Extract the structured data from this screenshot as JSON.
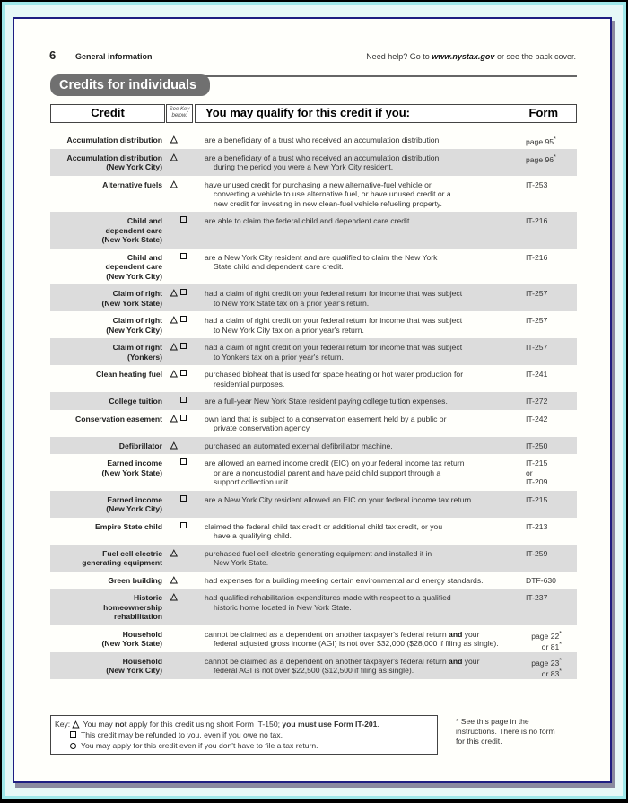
{
  "header": {
    "page_number": "6",
    "section": "General information",
    "help_prefix": "Need help? Go to ",
    "help_link": "www.nystax.gov",
    "help_suffix": " or see the back cover."
  },
  "title": "Credits for individuals",
  "table_header": {
    "credit": "Credit",
    "key_line1": "See Key",
    "key_line2": "below.",
    "qualify": "You may qualify for this credit if you:",
    "form": "Form"
  },
  "rows": [
    {
      "credit": [
        "Accumulation distribution"
      ],
      "keys": [
        "triangle"
      ],
      "desc": [
        "are a beneficiary of a trust who received an accumulation distribution."
      ],
      "form": [
        "page 95*"
      ],
      "shaded": false
    },
    {
      "credit": [
        "Accumulation distribution",
        "(New York City)"
      ],
      "keys": [
        "triangle"
      ],
      "desc": [
        "are a beneficiary of a trust who received an accumulation distribution",
        "during the period you were a New York City resident."
      ],
      "form": [
        "page 96*"
      ],
      "shaded": true
    },
    {
      "credit": [
        "Alternative fuels"
      ],
      "keys": [
        "triangle"
      ],
      "desc": [
        "have unused credit for purchasing a new alternative-fuel vehicle or",
        "converting a vehicle to use alternative fuel, or have unused credit or a",
        "new credit for investing in new clean-fuel vehicle refueling property."
      ],
      "form": [
        "IT-253"
      ],
      "shaded": false
    },
    {
      "credit": [
        "Child and",
        "dependent care",
        "(New York State)"
      ],
      "keys": [
        "square"
      ],
      "desc": [
        "are able to claim the federal child and dependent care credit."
      ],
      "form": [
        "IT-216"
      ],
      "shaded": true
    },
    {
      "credit": [
        "Child and",
        "dependent care",
        "(New York City)"
      ],
      "keys": [
        "square"
      ],
      "desc": [
        "are a New York City resident and are qualified to claim the New York",
        "State child and dependent care credit."
      ],
      "form": [
        "IT-216"
      ],
      "shaded": false
    },
    {
      "credit": [
        "Claim of right",
        "(New York State)"
      ],
      "keys": [
        "triangle",
        "square"
      ],
      "desc": [
        "had a claim of right credit on your federal return for income that was subject",
        "to New York State tax on a prior year's return."
      ],
      "form": [
        "IT-257"
      ],
      "shaded": true
    },
    {
      "credit": [
        "Claim of right",
        "(New York City)"
      ],
      "keys": [
        "triangle",
        "square"
      ],
      "desc": [
        "had a claim of right credit on your federal return for income that was subject",
        "to New York City tax on a prior year's return."
      ],
      "form": [
        "IT-257"
      ],
      "shaded": false
    },
    {
      "credit": [
        "Claim of right",
        "(Yonkers)"
      ],
      "keys": [
        "triangle",
        "square"
      ],
      "desc": [
        "had a claim of right credit on your federal return for income that was subject",
        "to Yonkers tax on a prior year's return."
      ],
      "form": [
        "IT-257"
      ],
      "shaded": true
    },
    {
      "credit": [
        "Clean heating fuel"
      ],
      "keys": [
        "triangle",
        "square"
      ],
      "desc": [
        "purchased bioheat that is used for space heating or hot water production for",
        "residential purposes."
      ],
      "form": [
        "IT-241"
      ],
      "shaded": false
    },
    {
      "credit": [
        "College tuition"
      ],
      "keys": [
        "square"
      ],
      "desc": [
        "are a full-year New York State resident paying college tuition expenses."
      ],
      "form": [
        "IT-272"
      ],
      "shaded": true
    },
    {
      "credit": [
        "Conservation easement"
      ],
      "keys": [
        "triangle",
        "square"
      ],
      "desc": [
        "own land that is subject to a conservation easement held by a public or",
        "private conservation agency."
      ],
      "form": [
        "IT-242"
      ],
      "shaded": false
    },
    {
      "credit": [
        "Defibrillator"
      ],
      "keys": [
        "triangle"
      ],
      "desc": [
        "purchased an automated external defibrillator machine."
      ],
      "form": [
        "IT-250"
      ],
      "shaded": true
    },
    {
      "credit": [
        "Earned income",
        "(New York State)"
      ],
      "keys": [
        "square"
      ],
      "desc": [
        "are allowed an earned income credit (EIC) on your federal income tax return",
        "or are a noncustodial parent and have paid child support through a",
        "support collection unit."
      ],
      "form": [
        "IT-215",
        "or",
        "IT-209"
      ],
      "shaded": false
    },
    {
      "credit": [
        "Earned income",
        "(New York City)"
      ],
      "keys": [
        "square"
      ],
      "desc": [
        "are a New York City resident allowed an EIC on your federal income tax return."
      ],
      "form": [
        "IT-215"
      ],
      "shaded": true
    },
    {
      "credit": [
        "Empire State child"
      ],
      "keys": [
        "square"
      ],
      "desc": [
        "claimed the federal child tax credit or additional child tax credit, or you",
        "have a qualifying child."
      ],
      "form": [
        "IT-213"
      ],
      "shaded": false
    },
    {
      "credit": [
        "Fuel cell electric",
        "generating equipment"
      ],
      "keys": [
        "triangle"
      ],
      "desc": [
        "purchased fuel cell electric generating equipment and installed it in",
        "New York State."
      ],
      "form": [
        "IT-259"
      ],
      "shaded": true
    },
    {
      "credit": [
        "Green building"
      ],
      "keys": [
        "triangle"
      ],
      "desc": [
        "had expenses for a building meeting certain environmental and energy standards."
      ],
      "form": [
        "DTF-630"
      ],
      "shaded": false
    },
    {
      "credit": [
        "Historic",
        "homeownership",
        "rehabilitation"
      ],
      "keys": [
        "triangle"
      ],
      "desc": [
        "had qualified rehabilitation expenditures made with respect to a qualified",
        "historic home located in New York State."
      ],
      "form": [
        "IT-237"
      ],
      "shaded": true
    },
    {
      "credit": [
        "Household",
        "(New York State)"
      ],
      "keys": [],
      "desc": [
        "cannot be claimed as a dependent on another taxpayer's federal return **and** your",
        "federal adjusted gross income (AGI) is not over $32,000 ($28,000 if filing as single)."
      ],
      "form": [
        "page 22*",
        "or 81*"
      ],
      "form_align": "right",
      "shaded": false
    },
    {
      "credit": [
        "Household",
        "(New York City)"
      ],
      "keys": [],
      "desc": [
        "cannot be claimed as a dependent on another taxpayer's federal return **and** your",
        "federal AGI is not over $22,500 ($12,500 if filing as single)."
      ],
      "form": [
        "page 23*",
        "or 83*"
      ],
      "form_align": "right",
      "shaded": true
    }
  ],
  "key": {
    "label": "Key:",
    "triangle_pre": "You may ",
    "triangle_bold1": "not",
    "triangle_mid": " apply for this credit using short Form IT-150; ",
    "triangle_bold2": "you must use Form IT-201",
    "triangle_end": ".",
    "square": "This credit may be refunded to you, even if you owe no tax.",
    "circle": "You may apply for this credit even if you don't have to file a tax return."
  },
  "footnote": "* See this page in the instructions. There is no form for this credit.",
  "colors": {
    "row_shade": "#dcdcdc",
    "title_pill": "#707070",
    "frame_border": "#1e1e82",
    "outer_frame": "#9fe8ea"
  }
}
